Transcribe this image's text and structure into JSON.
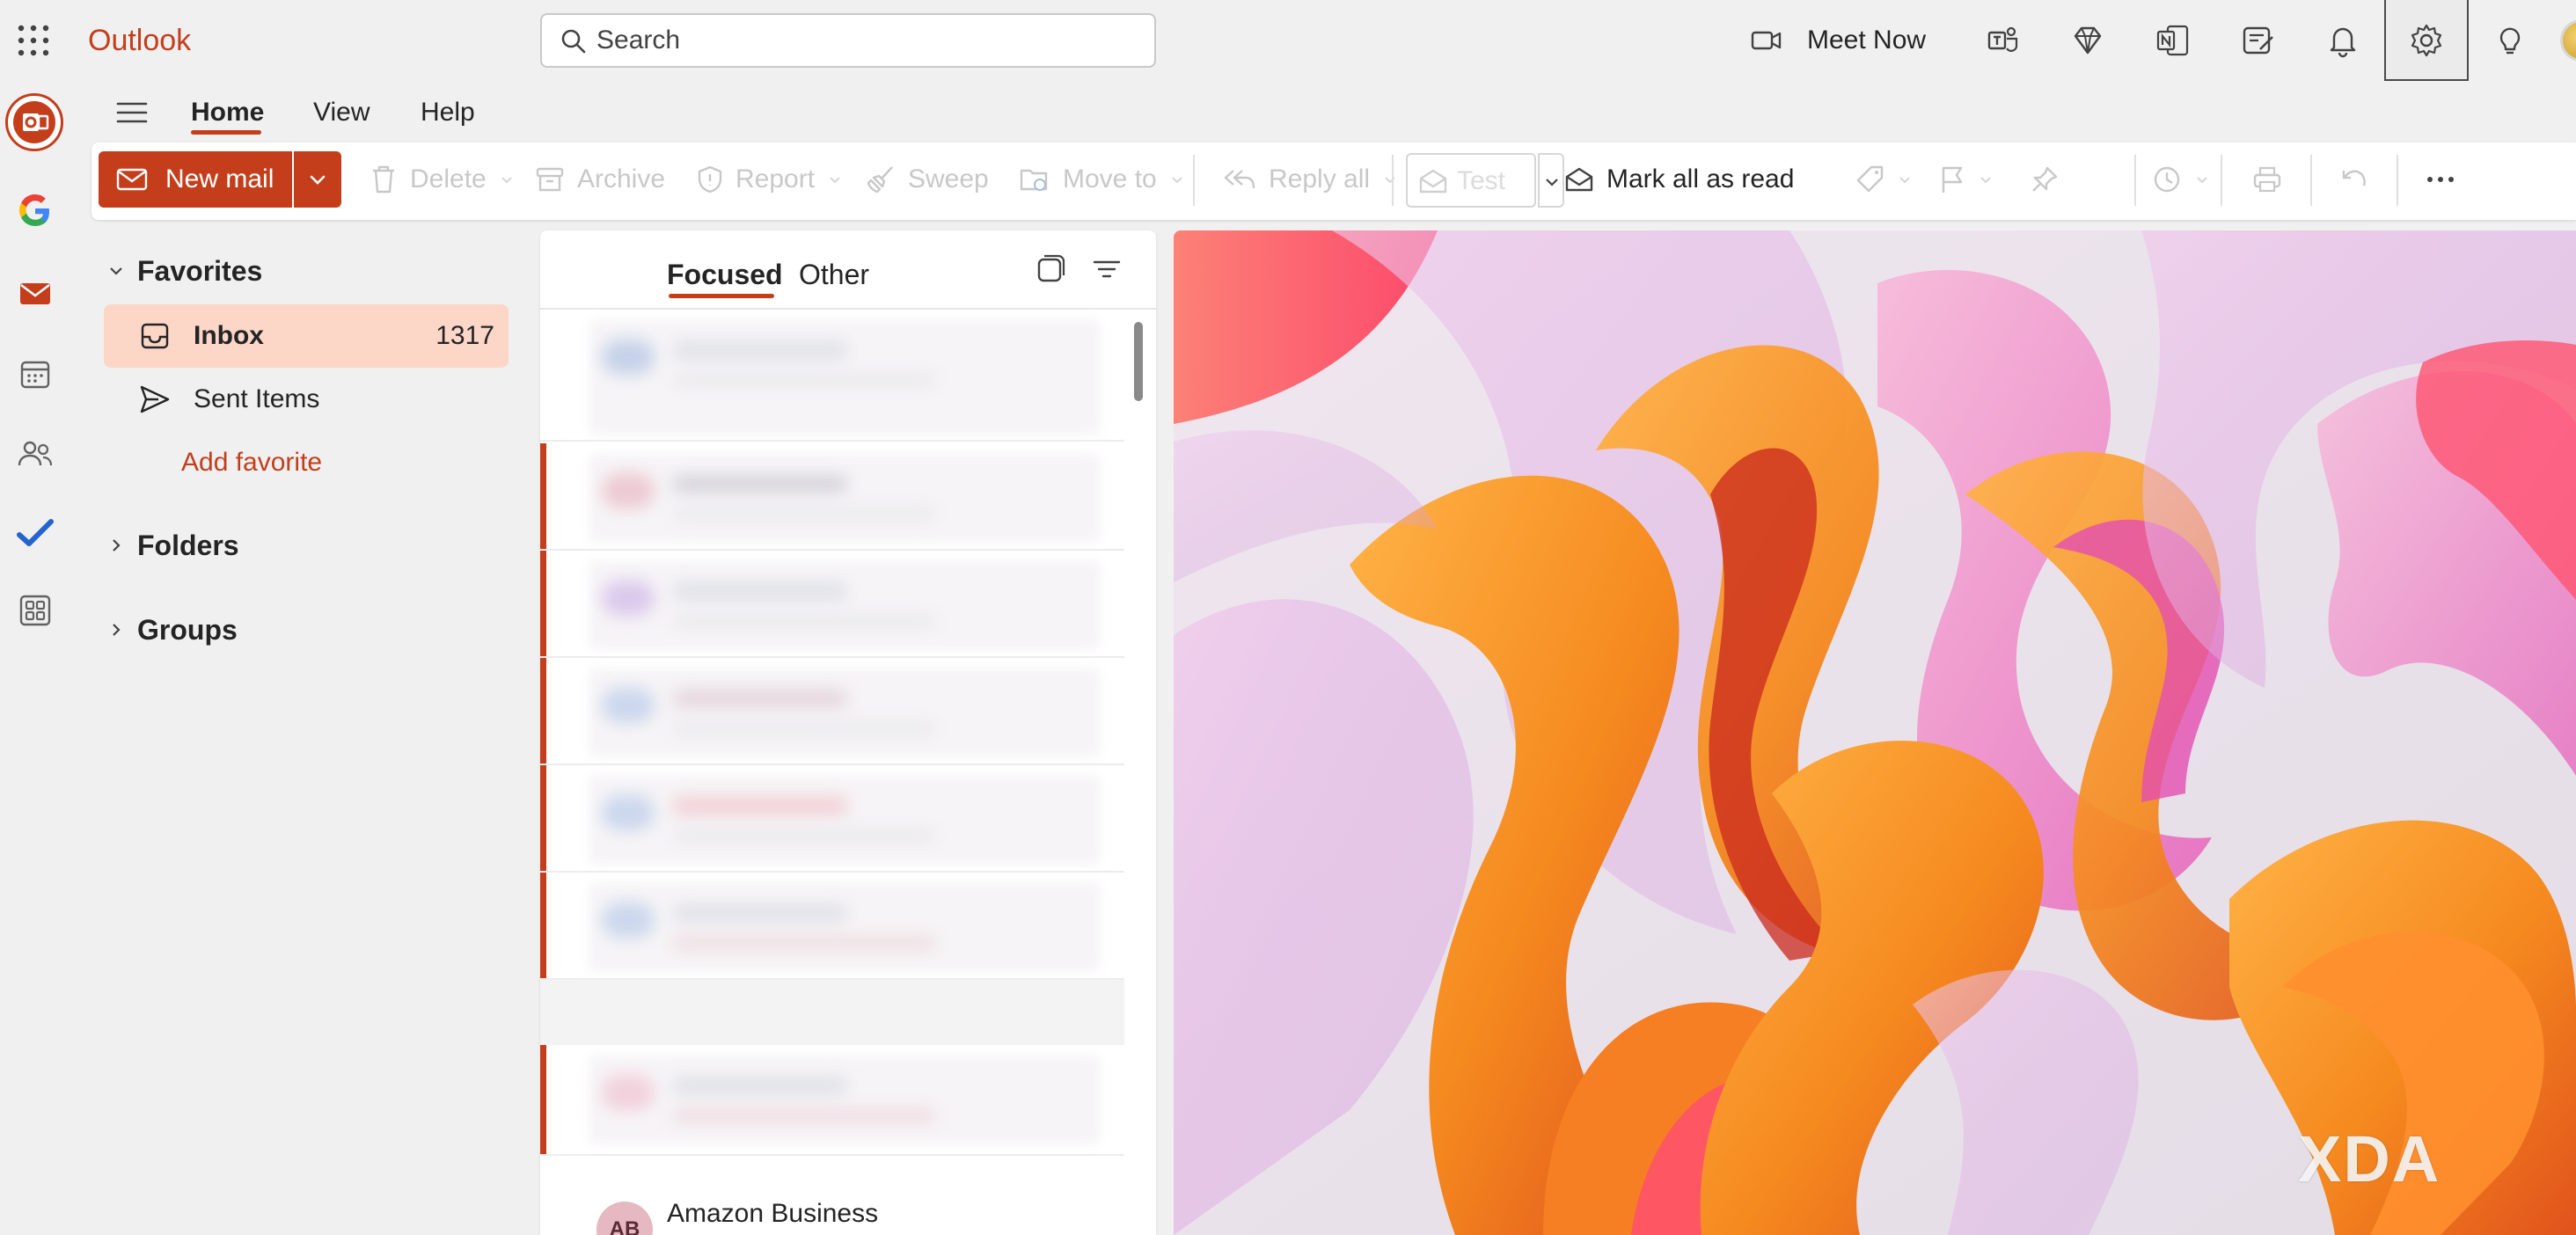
{
  "app": {
    "name": "Outlook",
    "accent": "#c43e1c",
    "accent_light": "#fcd7c8"
  },
  "header": {
    "search_placeholder": "Search",
    "meet_now_label": "Meet Now",
    "icons": [
      "teams-icon",
      "premium-diamond-icon",
      "onenote-icon",
      "my-day-icon",
      "notifications-bell-icon",
      "settings-gear-icon",
      "tips-lightbulb-icon"
    ]
  },
  "rail": {
    "items": [
      "outlook-app-icon",
      "google-account-icon",
      "mail-icon",
      "calendar-icon",
      "people-icon",
      "todo-check-icon",
      "more-apps-icon"
    ]
  },
  "ribbon": {
    "tabs": [
      {
        "label": "Home",
        "active": true
      },
      {
        "label": "View",
        "active": false
      },
      {
        "label": "Help",
        "active": false
      }
    ]
  },
  "commands": {
    "new_mail": "New mail",
    "delete": "Delete",
    "archive": "Archive",
    "report": "Report",
    "sweep": "Sweep",
    "move_to": "Move to",
    "reply_all": "Reply all",
    "test": "Test",
    "mark_all_read": "Mark all as read"
  },
  "folders": {
    "favorites_label": "Favorites",
    "items": [
      {
        "label": "Inbox",
        "count": "1317",
        "selected": true,
        "icon": "inbox-icon"
      },
      {
        "label": "Sent Items",
        "count": "",
        "selected": false,
        "icon": "send-icon"
      }
    ],
    "add_favorite": "Add favorite",
    "folders_label": "Folders",
    "groups_label": "Groups"
  },
  "message_list": {
    "pivots": [
      {
        "label": "Focused",
        "active": true
      },
      {
        "label": "Other",
        "active": false
      }
    ],
    "visible_sender": {
      "initials": "AB",
      "name": "Amazon Business"
    }
  },
  "watermark": "XDA"
}
